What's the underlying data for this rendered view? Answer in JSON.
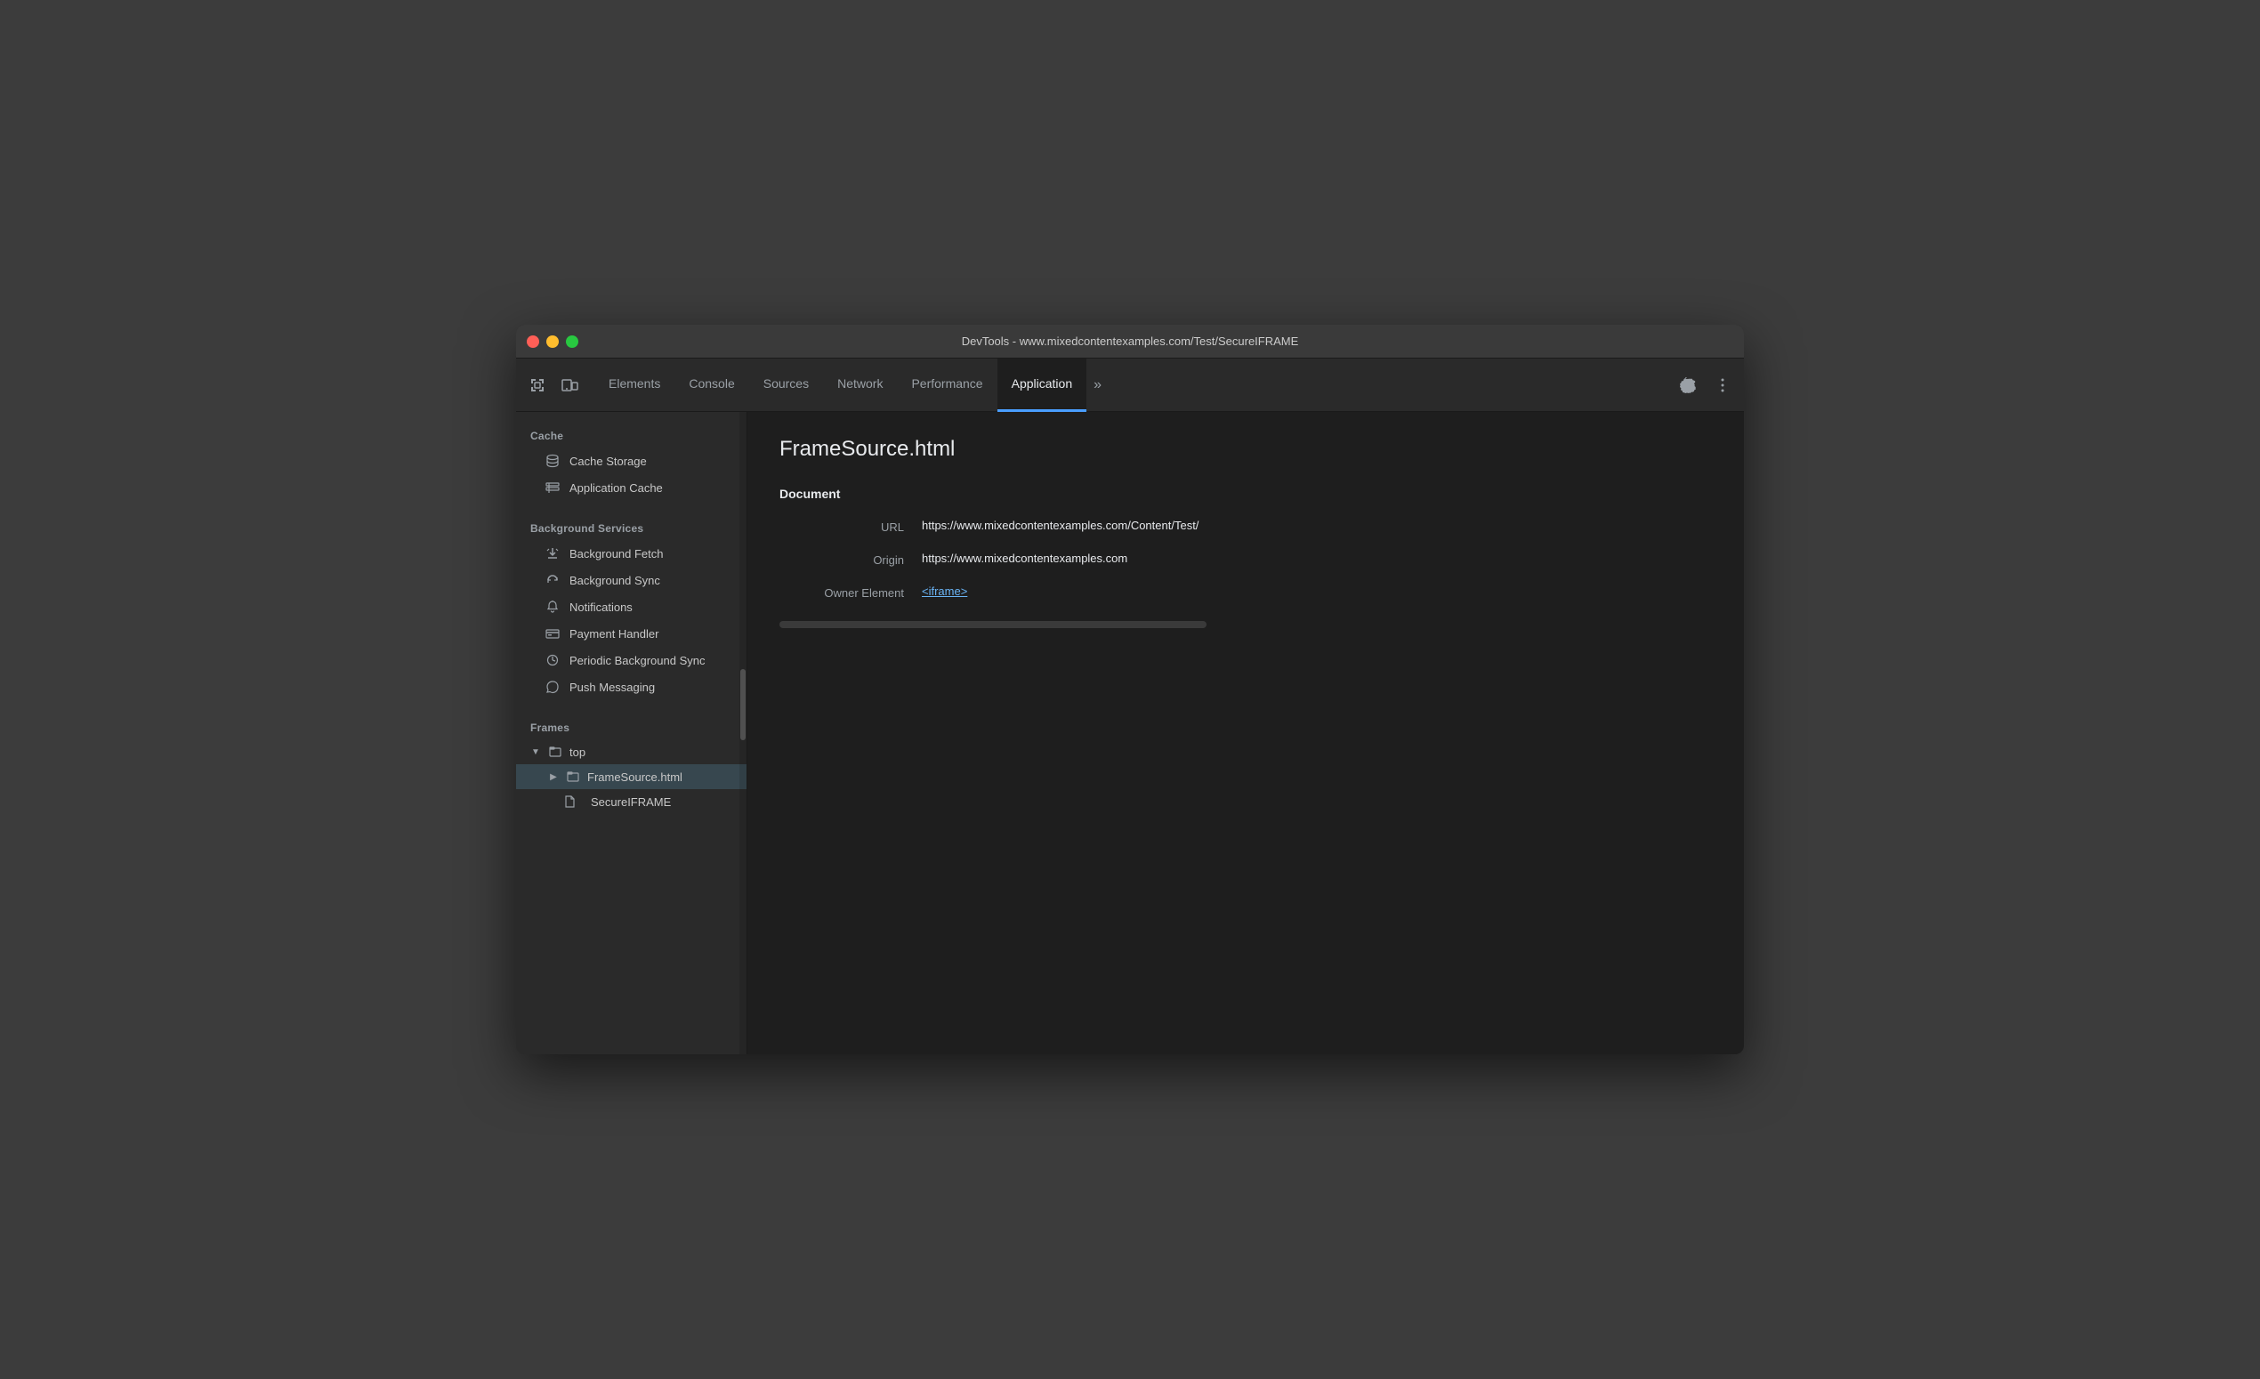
{
  "window": {
    "title": "DevTools - www.mixedcontentexamples.com/Test/SecureIFRAME"
  },
  "tabs": {
    "items": [
      {
        "id": "elements",
        "label": "Elements",
        "active": false
      },
      {
        "id": "console",
        "label": "Console",
        "active": false
      },
      {
        "id": "sources",
        "label": "Sources",
        "active": false
      },
      {
        "id": "network",
        "label": "Network",
        "active": false
      },
      {
        "id": "performance",
        "label": "Performance",
        "active": false
      },
      {
        "id": "application",
        "label": "Application",
        "active": true
      }
    ],
    "more_label": "»"
  },
  "sidebar": {
    "cache_section": "Cache",
    "cache_items": [
      {
        "id": "cache-storage",
        "label": "Cache Storage"
      },
      {
        "id": "application-cache",
        "label": "Application Cache"
      }
    ],
    "background_section": "Background Services",
    "background_items": [
      {
        "id": "background-fetch",
        "label": "Background Fetch"
      },
      {
        "id": "background-sync",
        "label": "Background Sync"
      },
      {
        "id": "notifications",
        "label": "Notifications"
      },
      {
        "id": "payment-handler",
        "label": "Payment Handler"
      },
      {
        "id": "periodic-background-sync",
        "label": "Periodic Background Sync"
      },
      {
        "id": "push-messaging",
        "label": "Push Messaging"
      }
    ],
    "frames_section": "Frames",
    "frames": {
      "top_label": "top",
      "frame_source_label": "FrameSource.html",
      "secure_iframe_label": "SecureIFRAME"
    }
  },
  "content": {
    "title": "FrameSource.html",
    "section_title": "Document",
    "url_label": "URL",
    "url_value": "https://www.mixedcontentexamples.com/Content/Test/",
    "origin_label": "Origin",
    "origin_value": "https://www.mixedcontentexamples.com",
    "owner_element_label": "Owner Element",
    "owner_element_value": "<iframe>"
  }
}
